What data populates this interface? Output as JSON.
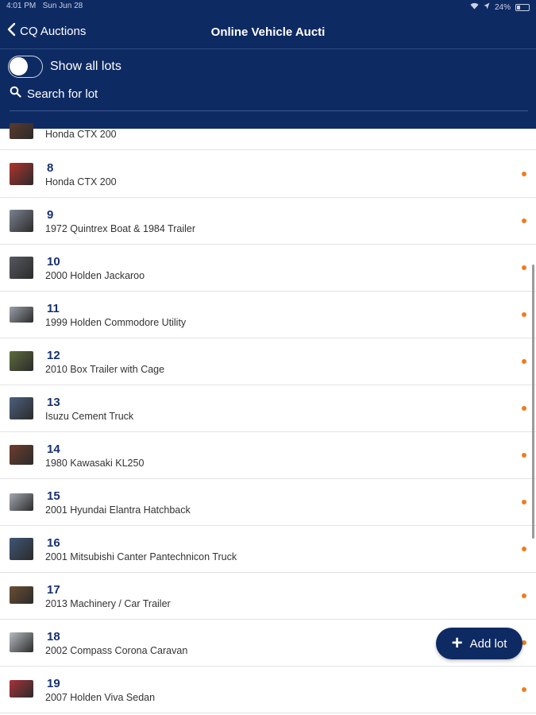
{
  "status_bar": {
    "time": "4:01 PM",
    "date": "Sun Jun 28",
    "battery": "24%",
    "icons": [
      "wifi-icon",
      "location-icon",
      "battery-icon"
    ]
  },
  "nav": {
    "back_label": "CQ Auctions",
    "title": "Online Vehicle Aucti"
  },
  "filters": {
    "show_all_label": "Show all lots",
    "show_all_on": false,
    "search_label": "Search for lot"
  },
  "lots": [
    {
      "number": "",
      "title": "Honda CTX 200",
      "thumb_color": "#5a3a2c"
    },
    {
      "number": "8",
      "title": "Honda CTX 200",
      "thumb_color": "#b1332c"
    },
    {
      "number": "9",
      "title": "1972 Quintrex Boat & 1984 Trailer",
      "thumb_color": "#7b8290"
    },
    {
      "number": "10",
      "title": "2000 Holden Jackaroo",
      "thumb_color": "#55585f"
    },
    {
      "number": "11",
      "title": "1999 Holden Commodore Utility",
      "thumb_color": "#9aa0a8"
    },
    {
      "number": "12",
      "title": "2010 Box Trailer with Cage",
      "thumb_color": "#5d6b3d"
    },
    {
      "number": "13",
      "title": "Isuzu Cement Truck",
      "thumb_color": "#4c5f7d"
    },
    {
      "number": "14",
      "title": "1980 Kawasaki KL250",
      "thumb_color": "#6d3d2d"
    },
    {
      "number": "15",
      "title": "2001 Hyundai Elantra Hatchback",
      "thumb_color": "#a3a9b1"
    },
    {
      "number": "16",
      "title": "2001 Mitsubishi Canter Pantechnicon Truck",
      "thumb_color": "#3f5676"
    },
    {
      "number": "17",
      "title": "2013 Machinery / Car Trailer",
      "thumb_color": "#6b4e33"
    },
    {
      "number": "18",
      "title": "2002 Compass Corona Caravan",
      "thumb_color": "#b7bcc2"
    },
    {
      "number": "19",
      "title": "2007 Holden Viva Sedan",
      "thumb_color": "#a8323a"
    }
  ],
  "fab": {
    "icon": "plus-icon",
    "label": "Add lot"
  },
  "colors": {
    "header": "#0e2a63",
    "accent_dot": "#f07c1f",
    "lot_number": "#17306e"
  }
}
